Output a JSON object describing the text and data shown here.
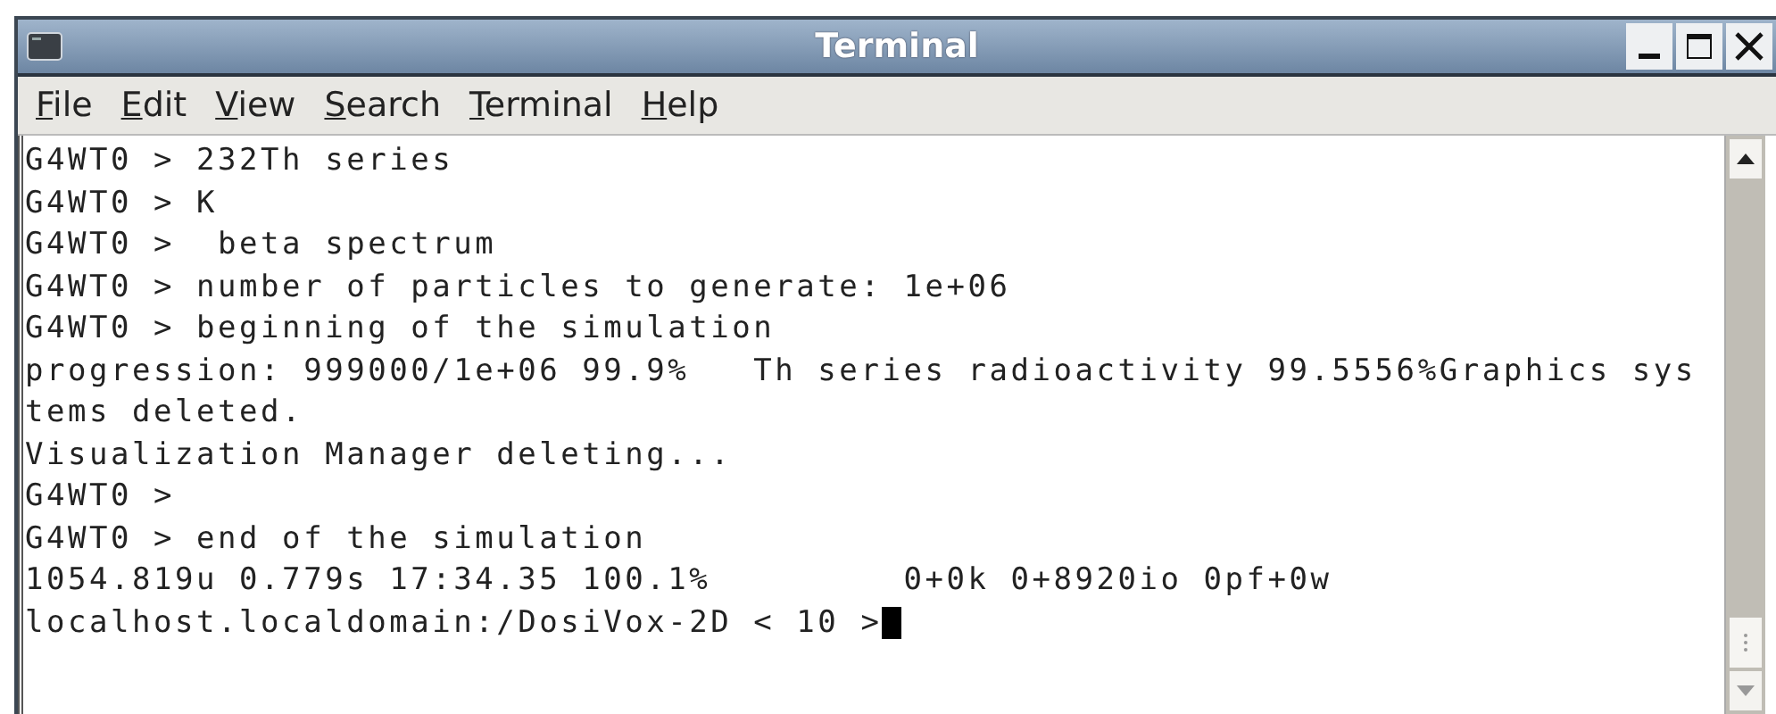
{
  "window": {
    "title": "Terminal"
  },
  "menu": [
    {
      "label": "File"
    },
    {
      "label": "Edit"
    },
    {
      "label": "View"
    },
    {
      "label": "Search"
    },
    {
      "label": "Terminal"
    },
    {
      "label": "Help"
    }
  ],
  "lines": [
    "G4WT0 > 232Th series",
    "G4WT0 > K",
    "G4WT0 >  beta spectrum",
    "G4WT0 > number of particles to generate: 1e+06",
    "G4WT0 > beginning of the simulation",
    "progression: 999000/1e+06 99.9%   Th series radioactivity 99.5556%Graphics sys",
    "tems deleted.",
    "Visualization Manager deleting...",
    "G4WT0 >",
    "G4WT0 > end of the simulation",
    "1054.819u 0.779s 17:34.35 100.1%         0+0k 0+8920io 0pf+0w",
    "localhost.localdomain:/DosiVox-2D < 10 >"
  ]
}
